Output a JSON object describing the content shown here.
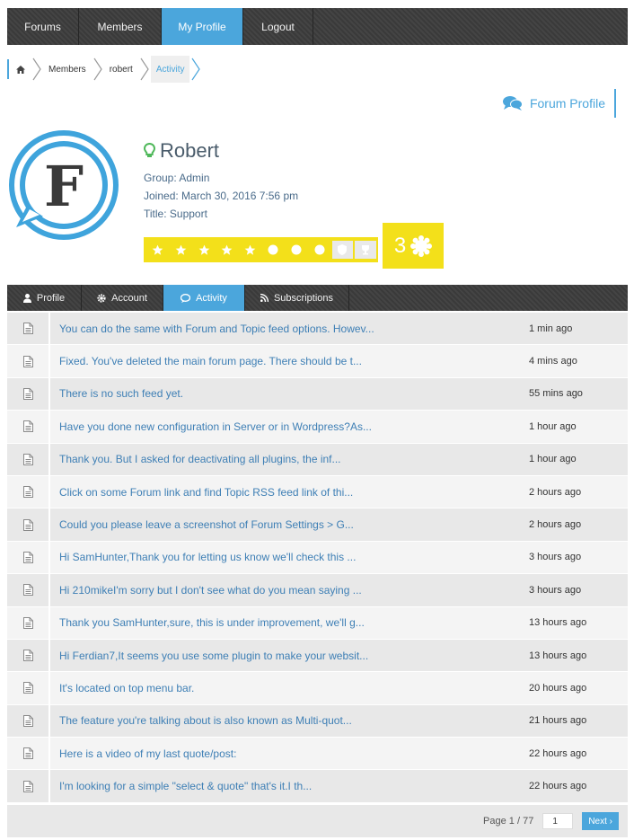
{
  "nav": {
    "items": [
      {
        "label": "Forums",
        "active": false
      },
      {
        "label": "Members",
        "active": false
      },
      {
        "label": "My Profile",
        "active": true
      },
      {
        "label": "Logout",
        "active": false
      }
    ]
  },
  "breadcrumb": {
    "home_icon": "home-icon",
    "items": [
      "Members",
      "robert",
      "Activity"
    ]
  },
  "forum_profile": {
    "label": "Forum Profile",
    "icon": "comments-icon"
  },
  "profile": {
    "avatar_letter": "F",
    "name": "Robert",
    "name_icon": "lightbulb-icon",
    "group": "Group: Admin",
    "joined": "Joined: March 30, 2016 7:56 pm",
    "title": "Title: Support",
    "rating": {
      "stars": 5,
      "circles": 3,
      "inactive_badges": 2
    },
    "rank": "3"
  },
  "tabs": [
    {
      "label": "Profile",
      "icon": "user-icon",
      "active": false
    },
    {
      "label": "Account",
      "icon": "gear-icon",
      "active": false
    },
    {
      "label": "Activity",
      "icon": "comment-icon",
      "active": true
    },
    {
      "label": "Subscriptions",
      "icon": "rss-icon",
      "active": false
    }
  ],
  "activity": [
    {
      "text": "You can do the same with Forum and Topic feed options. Howev...",
      "time": "1 min  ago"
    },
    {
      "text": "Fixed. You've deleted the main forum page. There should be t...",
      "time": "4 mins  ago"
    },
    {
      "text": "There is no such feed yet.",
      "time": "55 mins  ago"
    },
    {
      "text": "Have you done new configuration in Server or in Wordpress?As...",
      "time": "1 hour  ago"
    },
    {
      "text": "Thank you. But I asked for deactivating all plugins, the inf...",
      "time": "1 hour  ago"
    },
    {
      "text": "Click on some Forum link and find Topic RSS feed link of thi...",
      "time": "2 hours  ago"
    },
    {
      "text": "Could you please leave a screenshot of Forum Settings > G...",
      "time": "2 hours  ago"
    },
    {
      "text": "Hi SamHunter,Thank you for letting us know we'll check this ...",
      "time": "3 hours  ago"
    },
    {
      "text": "Hi 210mikeI'm sorry but I don't see what do you mean saying ...",
      "time": "3 hours  ago"
    },
    {
      "text": "Thank you SamHunter,sure, this is under improvement, we'll g...",
      "time": "13 hours  ago"
    },
    {
      "text": "Hi Ferdian7,It seems you use some plugin to make your websit...",
      "time": "13 hours  ago"
    },
    {
      "text": "It's located on top menu bar.",
      "time": "20 hours  ago"
    },
    {
      "text": "The feature you're talking about is also known as Multi-quot...",
      "time": "21 hours  ago"
    },
    {
      "text": "Here is a video of my last quote/post:",
      "time": "22 hours  ago"
    },
    {
      "text": "I'm looking for a simple \"select & quote\" that's it.I th...",
      "time": "22 hours  ago"
    }
  ],
  "pager": {
    "label": "Page 1 / 77",
    "value": "1",
    "next_label": "Next ›"
  },
  "colors": {
    "accent": "#4ba6dc",
    "nav_bg": "#3a3a3a",
    "rating_yellow": "#f3e01a",
    "link": "#3e7fb5"
  }
}
